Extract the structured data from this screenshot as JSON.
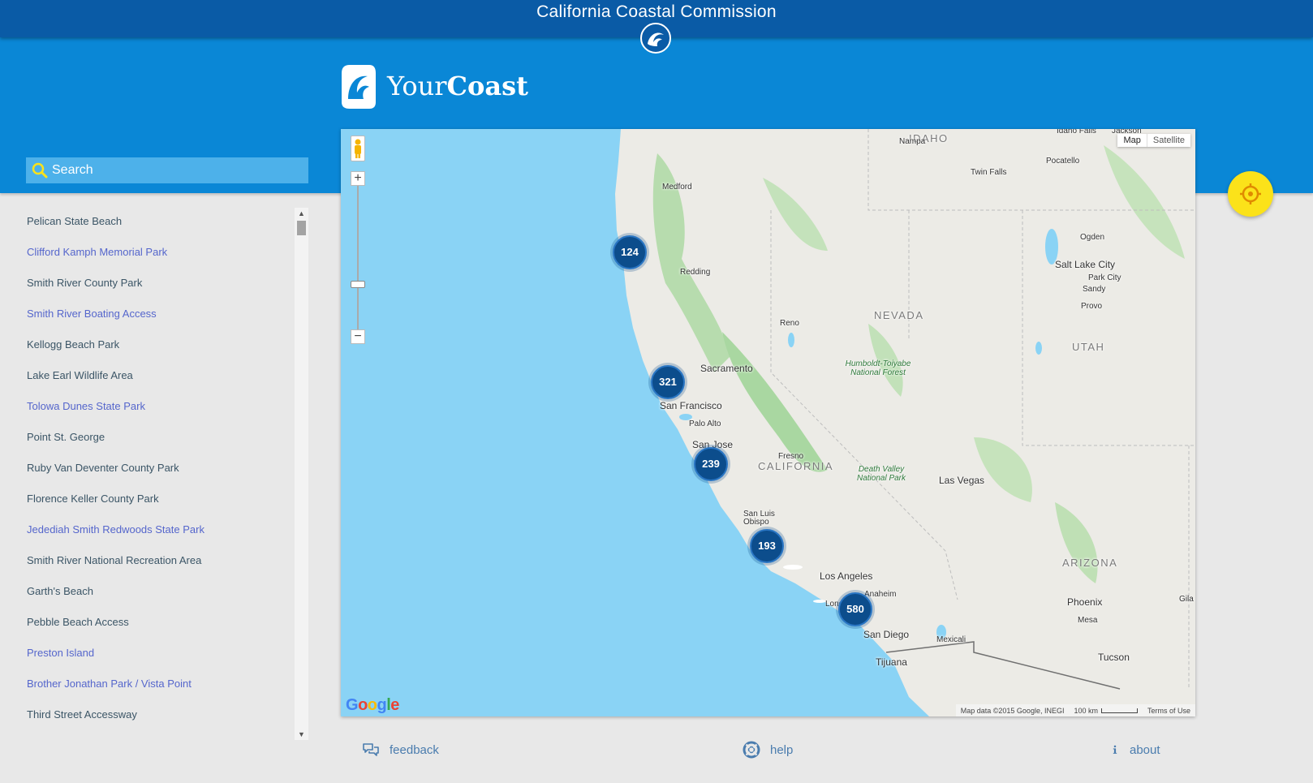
{
  "header": {
    "title": "California Coastal Commission"
  },
  "brand": {
    "name_light": "Your",
    "name_bold": "Coast"
  },
  "search": {
    "placeholder": "Search"
  },
  "locations": [
    {
      "name": "Pelican State Beach",
      "color": "#3b5566"
    },
    {
      "name": "Clifford Kamph Memorial Park",
      "color": "#5566cc"
    },
    {
      "name": "Smith River County Park",
      "color": "#3b5566"
    },
    {
      "name": "Smith River Boating Access",
      "color": "#5566cc"
    },
    {
      "name": "Kellogg Beach Park",
      "color": "#3b5566"
    },
    {
      "name": "Lake Earl Wildlife Area",
      "color": "#3b5566"
    },
    {
      "name": "Tolowa Dunes State Park",
      "color": "#5566cc"
    },
    {
      "name": "Point St. George",
      "color": "#3b5566"
    },
    {
      "name": "Ruby Van Deventer County Park",
      "color": "#3b5566"
    },
    {
      "name": "Florence Keller County Park",
      "color": "#3b5566"
    },
    {
      "name": "Jedediah Smith Redwoods State Park",
      "color": "#5566cc"
    },
    {
      "name": "Smith River National Recreation Area",
      "color": "#3b5566"
    },
    {
      "name": "Garth's Beach",
      "color": "#3b5566"
    },
    {
      "name": "Pebble Beach Access",
      "color": "#3b5566"
    },
    {
      "name": "Preston Island",
      "color": "#5566cc"
    },
    {
      "name": "Brother Jonathan Park / Vista Point",
      "color": "#5566cc"
    },
    {
      "name": "Third Street Accessway",
      "color": "#3b5566"
    }
  ],
  "map": {
    "type_controls": [
      "Map",
      "Satellite"
    ],
    "clusters": [
      "124",
      "321",
      "239",
      "193",
      "580"
    ],
    "states": [
      "IDAHO",
      "NEVADA",
      "UTAH",
      "CALIFORNIA",
      "ARIZONA"
    ],
    "cities": [
      "Nampa",
      "Idaho Falls",
      "Jackson",
      "Pocatello",
      "Twin Falls",
      "Medford",
      "Ogden",
      "Salt Lake City",
      "Park City",
      "Sandy",
      "Provo",
      "Redding",
      "Reno",
      "Sacramento",
      "San Francisco",
      "Palo Alto",
      "San Jose",
      "Fresno",
      "Las Vegas",
      "San Luis Obispo",
      "Los Angeles",
      "Anaheim",
      "Long Beach",
      "Phoenix",
      "Mesa",
      "San Diego",
      "Mexicali",
      "Tijuana",
      "Tucson",
      "Gila"
    ],
    "parks": [
      "Humboldt-Toiyabe National Forest",
      "Death Valley National Park"
    ],
    "attribution": "Map data ©2015 Google, INEGI",
    "scale": "100 km",
    "terms": "Terms of Use",
    "provider": "Google"
  },
  "footer": {
    "feedback": "feedback",
    "help": "help",
    "about": "about"
  },
  "colors": {
    "topbar": "#0a5ba6",
    "hero": "#0a87d6",
    "cluster": "#0c4d8c",
    "locate_button": "#fbe21a",
    "link": "#4a7cae"
  }
}
